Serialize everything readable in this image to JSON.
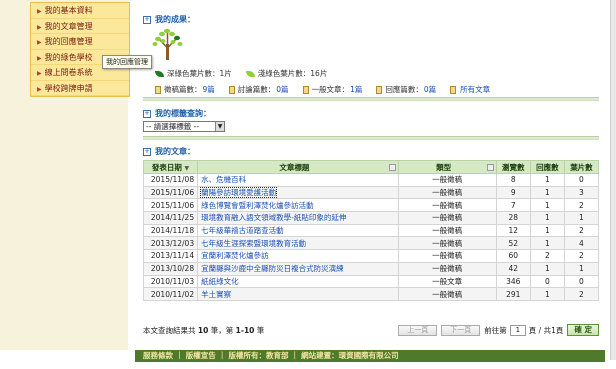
{
  "sidebar": {
    "items": [
      {
        "label": "我的基本資料"
      },
      {
        "label": "我的文章管理"
      },
      {
        "label": "我的回應管理"
      },
      {
        "label": "我的綠色學校"
      },
      {
        "label": "線上問卷系統"
      },
      {
        "label": "學校跨牌申請"
      }
    ],
    "tooltip": "我的回應管理"
  },
  "achievements": {
    "title": "我的成果：",
    "dark_leaves": "深綠色葉片數：1片",
    "light_leaves": "淺綠色葉片數：16片",
    "stats": [
      {
        "label": "徵稿篇數：",
        "value": "9篇"
      },
      {
        "label": "討論篇數：",
        "value": "0篇"
      },
      {
        "label": "一般文章：",
        "value": "1篇"
      },
      {
        "label": "回應篇數：",
        "value": "0篇"
      }
    ],
    "all_link": "所有文章",
    "colors": {
      "dark_leaf": "#1f7a1f",
      "light_leaf": "#8fcf3a"
    }
  },
  "tag_query": {
    "title": "我的標籤查詢：",
    "select_value": "-- 請選擇標籤 --"
  },
  "articles": {
    "title": "我的文章：",
    "columns": [
      "發表日期",
      "文章標題",
      "類型",
      "瀏覽數",
      "回應數",
      "葉片數"
    ],
    "rows": [
      {
        "date": "2015/11/08",
        "title": "水、危機百科",
        "type": "一般徵稿",
        "views": "8",
        "replies": "1",
        "leaves": "0"
      },
      {
        "date": "2015/11/06",
        "title": "蘭陽參訪環境愛護活動",
        "type": "一般徵稿",
        "views": "9",
        "replies": "1",
        "leaves": "3"
      },
      {
        "date": "2015/11/06",
        "title": "綠色博覽會暨利澤焚化爐參訪活動",
        "type": "一般徵稿",
        "views": "7",
        "replies": "1",
        "leaves": "2"
      },
      {
        "date": "2014/11/25",
        "title": "環境教育融入語文領域教學-紙貼印象的延伸",
        "type": "一般徵稿",
        "views": "28",
        "replies": "1",
        "leaves": "1"
      },
      {
        "date": "2014/11/18",
        "title": "七年級華禧古道踏查活動",
        "type": "一般徵稿",
        "views": "12",
        "replies": "1",
        "leaves": "2"
      },
      {
        "date": "2013/12/03",
        "title": "七年級生涯探索暨環境教育活動",
        "type": "一般徵稿",
        "views": "52",
        "replies": "1",
        "leaves": "4"
      },
      {
        "date": "2013/11/14",
        "title": "宜蘭利澤焚化爐參訪",
        "type": "一般徵稿",
        "views": "60",
        "replies": "2",
        "leaves": "2"
      },
      {
        "date": "2013/10/28",
        "title": "宜蘭縣與沙鹿中全縣防災日複合式防災演練",
        "type": "一般徵稿",
        "views": "42",
        "replies": "1",
        "leaves": "1"
      },
      {
        "date": "2010/11/03",
        "title": "紙紙綠文化",
        "type": "一般文章",
        "views": "346",
        "replies": "0",
        "leaves": "0"
      },
      {
        "date": "2010/11/02",
        "title": "羊土實察",
        "type": "一般徵稿",
        "views": "291",
        "replies": "1",
        "leaves": "2"
      }
    ]
  },
  "pager": {
    "summary_prefix": "本文查詢結果共",
    "total": "10",
    "summary_mid": "筆，第",
    "range": "1-10",
    "summary_suffix": "筆",
    "prev": "上一頁",
    "next": "下一頁",
    "goto_prefix": "前往第",
    "page": "1",
    "goto_suffix": "頁 / 共1頁",
    "confirm": "確 定"
  },
  "footer": {
    "text": "服務條款 ｜ 版權宣告 ｜ 版權所有：教育部 ｜ 網站建置：環資國際有限公司"
  }
}
